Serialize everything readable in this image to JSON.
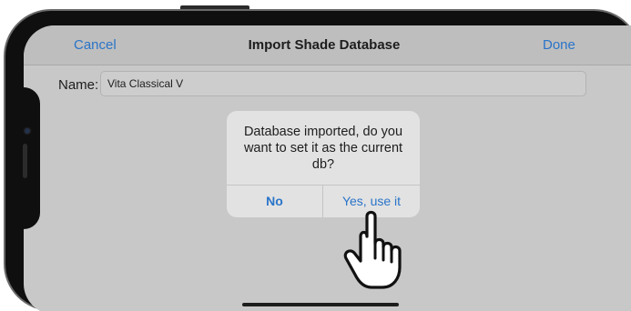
{
  "navbar": {
    "cancel_label": "Cancel",
    "title": "Import Shade Database",
    "done_label": "Done"
  },
  "form": {
    "name_label": "Name:",
    "name_value": "Vita Classical V"
  },
  "alert": {
    "message": "Database imported, do you want to set it as the current db?",
    "no_label": "No",
    "yes_label": "Yes, use it"
  },
  "icons": {
    "pointer": "hand-pointer-icon"
  },
  "colors": {
    "accent": "#2a74c9",
    "screen_background": "#c8c8c8",
    "alert_background": "#e2e2e2",
    "phone_frame": "#0f0f0f"
  }
}
